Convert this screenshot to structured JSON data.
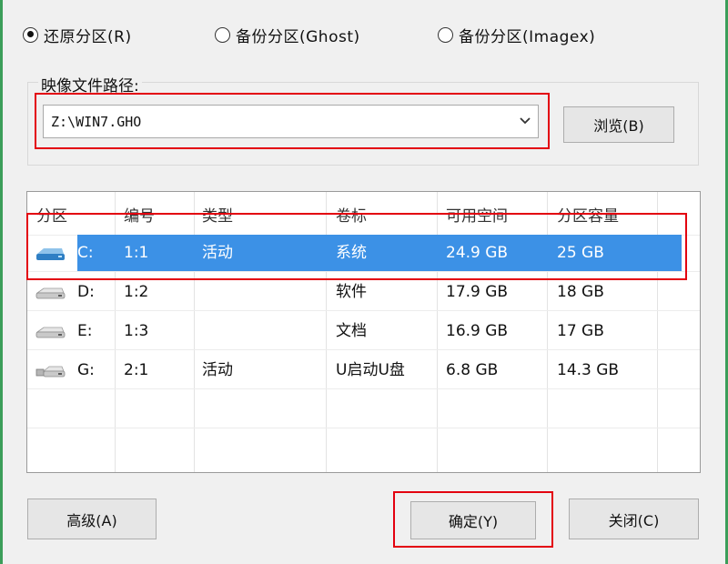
{
  "restore_options": {
    "restore": "还原分区(R)",
    "backup_ghost": "备份分区(Ghost)",
    "backup_imagex": "备份分区(Imagex)",
    "selected": "restore"
  },
  "image_path": {
    "label": "映像文件路径:",
    "value": "Z:\\WIN7.GHO",
    "browse_button": "浏览(B)"
  },
  "partitions": {
    "columns": [
      "分区",
      "编号",
      "类型",
      "卷标",
      "可用空间",
      "分区容量"
    ],
    "rows": [
      {
        "drive": "C:",
        "number": "1:1",
        "type": "活动",
        "label": "系统",
        "free": "24.9 GB",
        "capacity": "25 GB",
        "icon": "system-drive-icon",
        "selected": true
      },
      {
        "drive": "D:",
        "number": "1:2",
        "type": "",
        "label": "软件",
        "free": "17.9 GB",
        "capacity": "18 GB",
        "icon": "hard-drive-icon",
        "selected": false
      },
      {
        "drive": "E:",
        "number": "1:3",
        "type": "",
        "label": "文档",
        "free": "16.9 GB",
        "capacity": "17 GB",
        "icon": "hard-drive-icon",
        "selected": false
      },
      {
        "drive": "G:",
        "number": "2:1",
        "type": "活动",
        "label": "U启动U盘",
        "free": "6.8 GB",
        "capacity": "14.3 GB",
        "icon": "usb-drive-icon",
        "selected": false
      }
    ]
  },
  "footer": {
    "advanced": "高级(A)",
    "ok": "确定(Y)",
    "close": "关闭(C)"
  },
  "colors": {
    "selection": "#3c91e6",
    "highlight_box": "#e3000f",
    "frame_edge": "#3c9e5a"
  }
}
